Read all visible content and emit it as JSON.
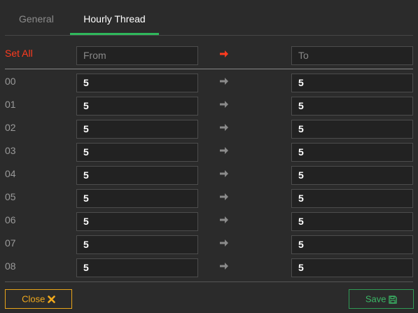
{
  "tabs": {
    "general": "General",
    "hourly": "Hourly Thread"
  },
  "header": {
    "set_all": "Set All",
    "from_placeholder": "From",
    "to_placeholder": "To"
  },
  "rows": [
    {
      "hour": "00",
      "from": "5",
      "to": "5"
    },
    {
      "hour": "01",
      "from": "5",
      "to": "5"
    },
    {
      "hour": "02",
      "from": "5",
      "to": "5"
    },
    {
      "hour": "03",
      "from": "5",
      "to": "5"
    },
    {
      "hour": "04",
      "from": "5",
      "to": "5"
    },
    {
      "hour": "05",
      "from": "5",
      "to": "5"
    },
    {
      "hour": "06",
      "from": "5",
      "to": "5"
    },
    {
      "hour": "07",
      "from": "5",
      "to": "5"
    },
    {
      "hour": "08",
      "from": "5",
      "to": "5"
    }
  ],
  "footer": {
    "close_label": "Close",
    "save_label": "Save"
  },
  "colors": {
    "accent_green": "#2fb85c",
    "set_all_red": "#ff3b1f",
    "close_orange": "#f2aa1c",
    "save_green": "#3bb766"
  },
  "icons": {
    "set_all_arrow": "arrow-right-icon",
    "row_arrow": "arrow-right-icon",
    "close": "close-x-icon",
    "save": "floppy-disk-icon"
  }
}
